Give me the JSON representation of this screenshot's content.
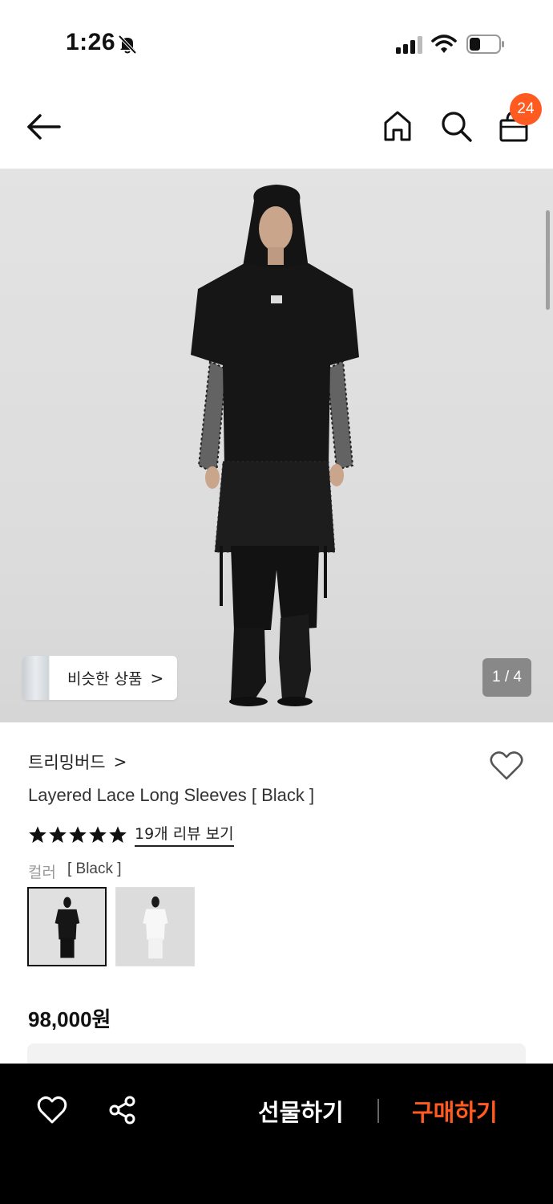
{
  "status_bar": {
    "time": "1:26"
  },
  "header": {
    "cart_count": "24",
    "icons": [
      "back-arrow-icon",
      "home-icon",
      "search-icon",
      "shopping-bag-icon"
    ]
  },
  "hero": {
    "similar_label": "비슷한 상품",
    "similar_chevron": ">",
    "page_indicator": "1 / 4"
  },
  "product": {
    "brand": "트리밍버드",
    "brand_chevron": ">",
    "name": "Layered Lace Long Sleeves [ Black ]",
    "rating_stars": 5,
    "review_link": "19개 리뷰 보기",
    "color_label": "컬러",
    "color_value": "[ Black ]",
    "swatches": [
      "Black",
      "White"
    ],
    "price": "98,000원"
  },
  "bottom_bar": {
    "gift_label": "선물하기",
    "buy_label": "구매하기"
  },
  "colors": {
    "accent": "#ff5a1f",
    "bottom_bar_bg": "#000000"
  }
}
